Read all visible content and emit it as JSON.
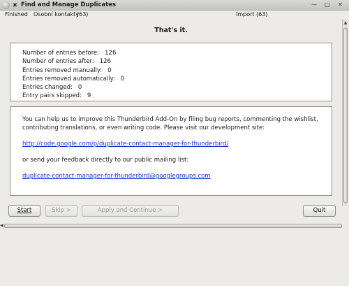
{
  "window": {
    "title": "Find and Manage Duplicates",
    "menu_icon": "window-menu-icon",
    "pin_glyph": "✖",
    "shade_glyph": "—",
    "max_glyph": "□",
    "close_glyph": "✕"
  },
  "status": {
    "state": "Finished",
    "left_book": "Osobní kontakty",
    "left_count": "(63)",
    "right_book": "Import",
    "right_count": "(63)"
  },
  "headline": "That's it.",
  "stats": [
    {
      "label": "Number of entries before:",
      "value": "126"
    },
    {
      "label": "Number of entries after:",
      "value": "126"
    },
    {
      "label": "Entries removed manually:",
      "value": "0"
    },
    {
      "label": "Entries removed automatically:",
      "value": "0"
    },
    {
      "label": "Entries changed:",
      "value": "0"
    },
    {
      "label": "Entry pairs skipped:",
      "value": "9"
    }
  ],
  "info": {
    "paragraph1": "You can help us to improve this Thunderbird Add-On by filing bug reports, commenting the wishlist, contributing translations, or even writing code. Please visit our development site:",
    "dev_link": "http://code.google.com/p/duplicate-contact-manager-for-thunderbird/",
    "paragraph2": "or send your feedback directly to our public mailing list:",
    "mail_link": "duplicate-contact-manager-for-thunderbird@googlegroups.com"
  },
  "buttons": {
    "start": "Start",
    "skip": "Skip >",
    "apply": "Apply and Continue >",
    "quit": "Quit"
  },
  "scroll": {
    "up_glyph": "▲",
    "left_glyph": "◀"
  }
}
